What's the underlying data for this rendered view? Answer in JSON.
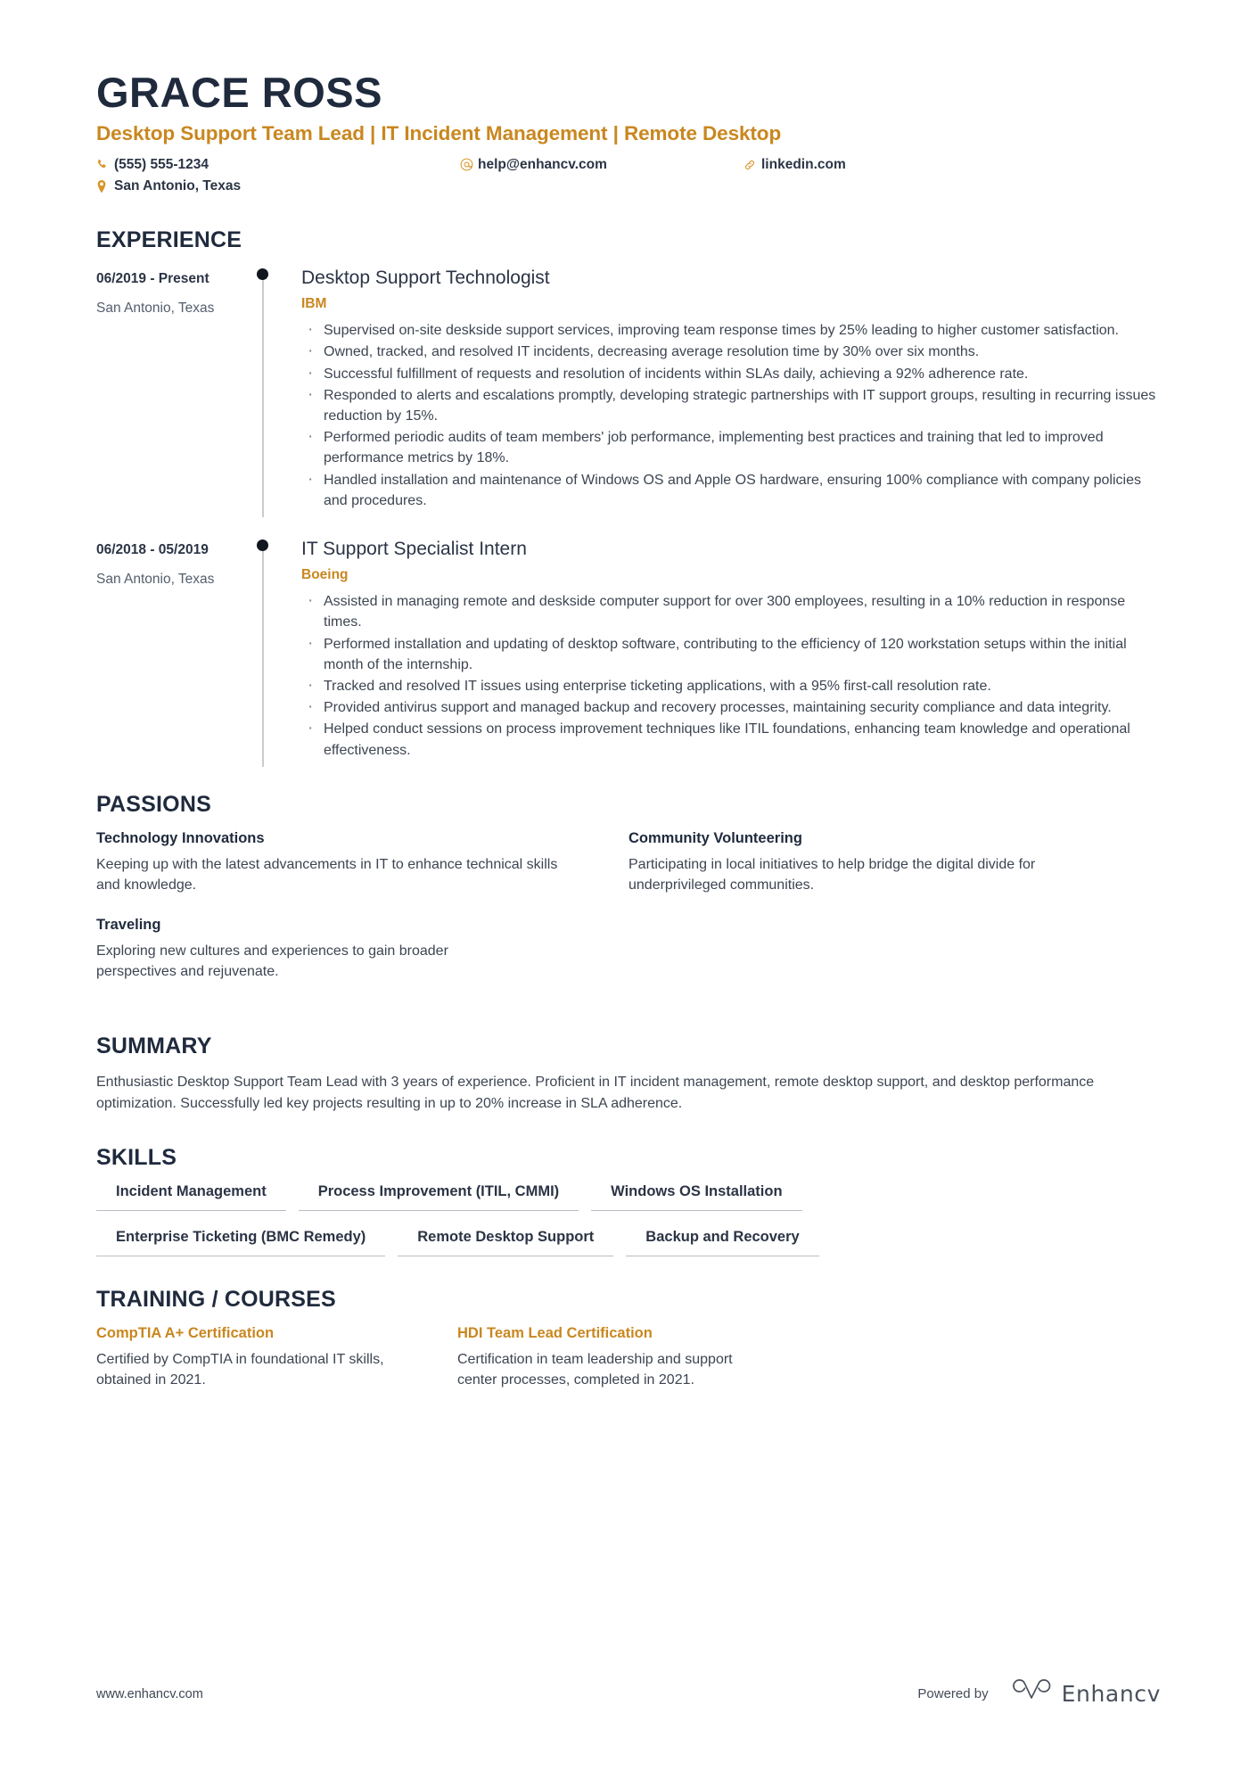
{
  "header": {
    "name": "GRACE ROSS",
    "headline": "Desktop Support Team Lead | IT Incident Management | Remote Desktop",
    "contacts": [
      {
        "icon": "phone-icon",
        "text": "(555) 555-1234"
      },
      {
        "icon": "email-icon",
        "text": "help@enhancv.com"
      },
      {
        "icon": "link-icon",
        "text": "linkedin.com"
      },
      {
        "icon": "location-icon",
        "text": "San Antonio, Texas"
      }
    ]
  },
  "experience": {
    "title": "EXPERIENCE",
    "entries": [
      {
        "date": "06/2019 - Present",
        "location": "San Antonio, Texas",
        "role": "Desktop Support Technologist",
        "company": "IBM",
        "bullets": [
          "Supervised on-site deskside support services, improving team response times by 25% leading to higher customer satisfaction.",
          "Owned, tracked, and resolved IT incidents, decreasing average resolution time by 30% over six months.",
          "Successful fulfillment of requests and resolution of incidents within SLAs daily, achieving a 92% adherence rate.",
          "Responded to alerts and escalations promptly, developing strategic partnerships with IT support groups, resulting in recurring issues reduction by 15%.",
          "Performed periodic audits of team members' job performance, implementing best practices and training that led to improved performance metrics by 18%.",
          "Handled installation and maintenance of Windows OS and Apple OS hardware, ensuring 100% compliance with company policies and procedures."
        ]
      },
      {
        "date": "06/2018 - 05/2019",
        "location": "San Antonio, Texas",
        "role": "IT Support Specialist Intern",
        "company": "Boeing",
        "bullets": [
          "Assisted in managing remote and deskside computer support for over 300 employees, resulting in a 10% reduction in response times.",
          "Performed installation and updating of desktop software, contributing to the efficiency of 120 workstation setups within the initial month of the internship.",
          "Tracked and resolved IT issues using enterprise ticketing applications, with a 95% first-call resolution rate.",
          "Provided antivirus support and managed backup and recovery processes, maintaining security compliance and data integrity.",
          "Helped conduct sessions on process improvement techniques like ITIL foundations, enhancing team knowledge and operational effectiveness."
        ]
      }
    ]
  },
  "passions": {
    "title": "PASSIONS",
    "items": [
      {
        "title": "Technology Innovations",
        "desc": "Keeping up with the latest advancements in IT to enhance technical skills and knowledge."
      },
      {
        "title": "Community Volunteering",
        "desc": "Participating in local initiatives to help bridge the digital divide for underprivileged communities."
      },
      {
        "title": "Traveling",
        "desc": "Exploring new cultures and experiences to gain broader perspectives and rejuvenate."
      }
    ]
  },
  "summary": {
    "title": "SUMMARY",
    "text": "Enthusiastic Desktop Support Team Lead with 3 years of experience. Proficient in IT incident management, remote desktop support, and desktop performance optimization. Successfully led key projects resulting in up to 20% increase in SLA adherence."
  },
  "skills": {
    "title": "SKILLS",
    "rows": [
      [
        "Incident Management",
        "Process Improvement (ITIL, CMMI)",
        "Windows OS Installation"
      ],
      [
        "Enterprise Ticketing (BMC Remedy)",
        "Remote Desktop Support",
        "Backup and Recovery"
      ]
    ]
  },
  "training": {
    "title": "TRAINING / COURSES",
    "items": [
      {
        "title": "CompTIA A+ Certification",
        "desc": "Certified by CompTIA in foundational IT skills, obtained in 2021."
      },
      {
        "title": "HDI Team Lead Certification",
        "desc": "Certification in team leadership and support center processes, completed in 2021."
      }
    ]
  },
  "footer": {
    "url": "www.enhancv.com",
    "powered_by": "Powered by",
    "brand": "Enhancv"
  },
  "colors": {
    "accent": "#c9871f",
    "dark": "#1f2a3d",
    "body": "#3d4552"
  }
}
